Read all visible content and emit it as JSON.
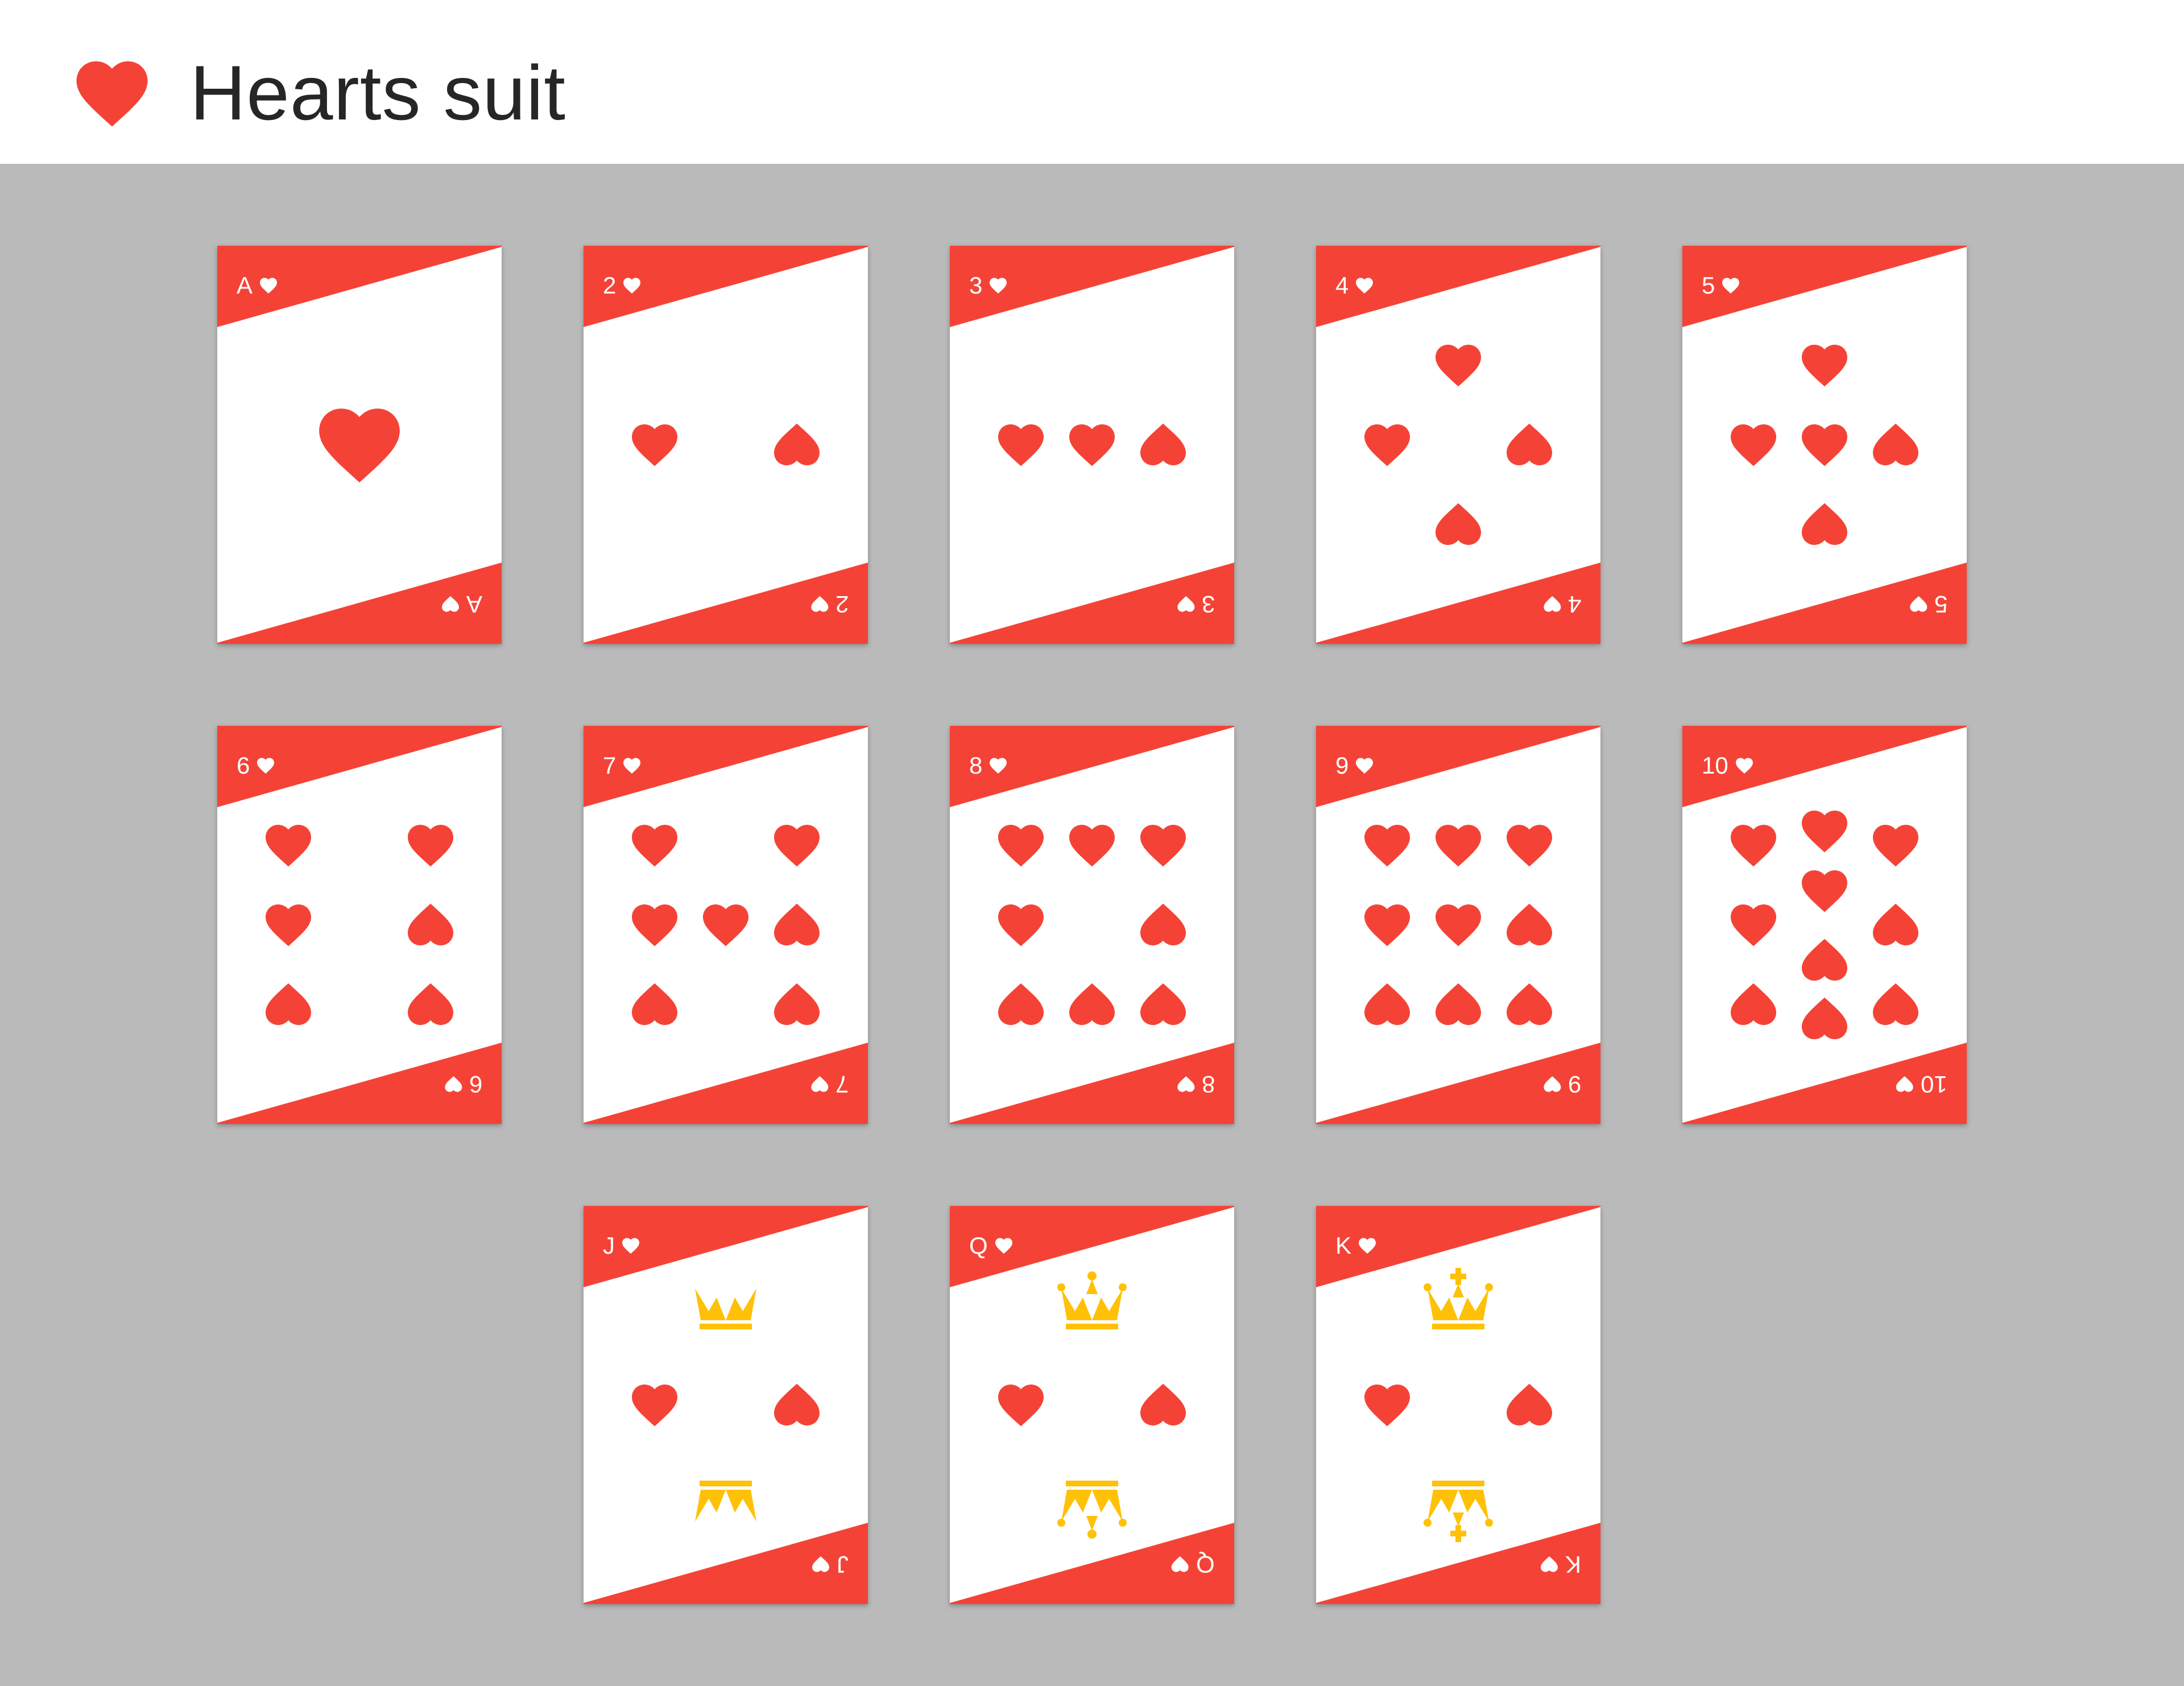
{
  "header": {
    "title": "Hearts suit",
    "icon": "heart-icon"
  },
  "colors": {
    "card_red": "#f44336",
    "card_face": "#ffffff",
    "crown_gold": "#ffc107",
    "table_background": "#bababa",
    "header_background": "#ffffff"
  },
  "cards": [
    {
      "rank": "A",
      "suit": "hearts",
      "pips": 1
    },
    {
      "rank": "2",
      "suit": "hearts",
      "pips": 2
    },
    {
      "rank": "3",
      "suit": "hearts",
      "pips": 3
    },
    {
      "rank": "4",
      "suit": "hearts",
      "pips": 4
    },
    {
      "rank": "5",
      "suit": "hearts",
      "pips": 5
    },
    {
      "rank": "6",
      "suit": "hearts",
      "pips": 6
    },
    {
      "rank": "7",
      "suit": "hearts",
      "pips": 7
    },
    {
      "rank": "8",
      "suit": "hearts",
      "pips": 8
    },
    {
      "rank": "9",
      "suit": "hearts",
      "pips": 9
    },
    {
      "rank": "10",
      "suit": "hearts",
      "pips": 10
    },
    {
      "rank": "J",
      "suit": "hearts",
      "pips": 2,
      "crown": "jack-crown-icon"
    },
    {
      "rank": "Q",
      "suit": "hearts",
      "pips": 2,
      "crown": "queen-crown-icon"
    },
    {
      "rank": "K",
      "suit": "hearts",
      "pips": 2,
      "crown": "king-crown-icon"
    }
  ]
}
